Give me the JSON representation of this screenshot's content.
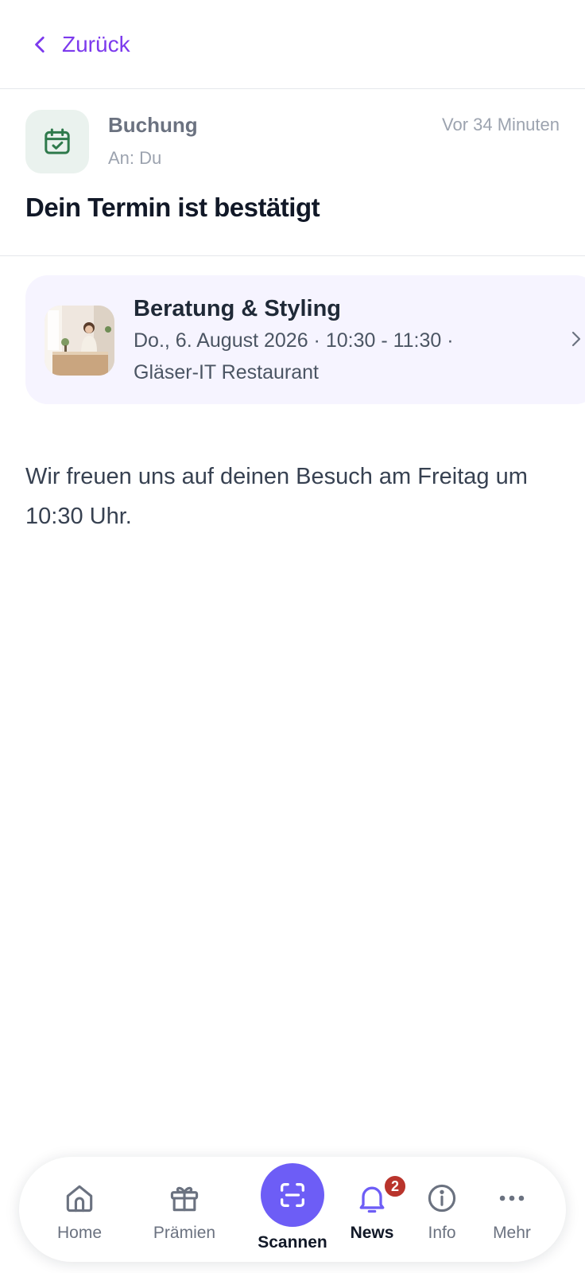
{
  "topbar": {
    "back_label": "Zurück"
  },
  "message": {
    "category": "Buchung",
    "recipient": "An: Du",
    "time": "Vor 34 Minuten",
    "title": "Dein Termin ist bestätigt",
    "body": "Wir freuen uns auf deinen Besuch am Freitag um 10:30 Uhr."
  },
  "booking": {
    "service": "Beratung & Styling",
    "when": "Do., 6. August 2026 · 10:30 - 11:30 ·",
    "where": "Gläser-IT Restaurant"
  },
  "nav": {
    "home": "Home",
    "rewards": "Prämien",
    "scan": "Scannen",
    "news": "News",
    "news_badge": "2",
    "info": "Info",
    "more": "Mehr"
  },
  "colors": {
    "accent": "#7c3aed",
    "scan_button": "#6d5df6",
    "card_bg": "#f6f4ff",
    "category_icon_bg": "#eaf2ee",
    "category_icon": "#2f7a4c",
    "badge": "#b9342c"
  },
  "icons": {
    "back": "chevron-left-icon",
    "category": "calendar-check-icon",
    "card": "chevron-right-icon",
    "home": "home-icon",
    "rewards": "gift-icon",
    "scan": "scan-icon",
    "news": "bell-icon",
    "info": "info-icon",
    "more": "more-dots-icon"
  }
}
